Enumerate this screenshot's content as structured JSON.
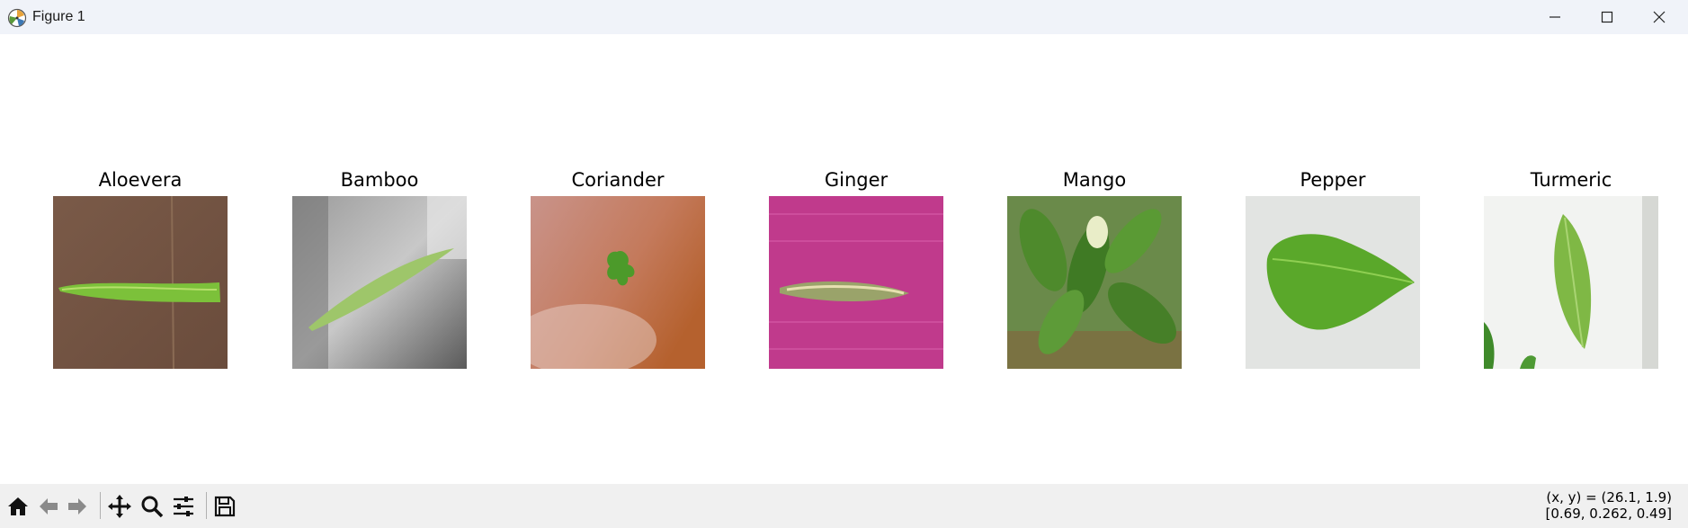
{
  "window": {
    "title": "Figure 1",
    "icons": {
      "app": "matplotlib-icon",
      "minimize": "minimize-icon",
      "maximize": "maximize-icon",
      "close": "close-icon"
    }
  },
  "figure": {
    "panels": [
      {
        "title": "Aloevera",
        "image": "aloevera-leaf-photo"
      },
      {
        "title": "Bamboo",
        "image": "bamboo-leaf-photo"
      },
      {
        "title": "Coriander",
        "image": "coriander-leaf-photo"
      },
      {
        "title": "Ginger",
        "image": "ginger-leaf-photo"
      },
      {
        "title": "Mango",
        "image": "mango-leaves-photo"
      },
      {
        "title": "Pepper",
        "image": "pepper-leaf-photo"
      },
      {
        "title": "Turmeric",
        "image": "turmeric-leaf-photo"
      }
    ]
  },
  "toolbar": {
    "buttons": [
      "home-icon",
      "back-icon",
      "forward-icon",
      "pan-icon",
      "zoom-icon",
      "configure-subplots-icon",
      "save-icon"
    ],
    "coords_line1": "(x, y) = (26.1, 1.9)",
    "coords_line2": "[0.69, 0.262, 0.49]"
  }
}
